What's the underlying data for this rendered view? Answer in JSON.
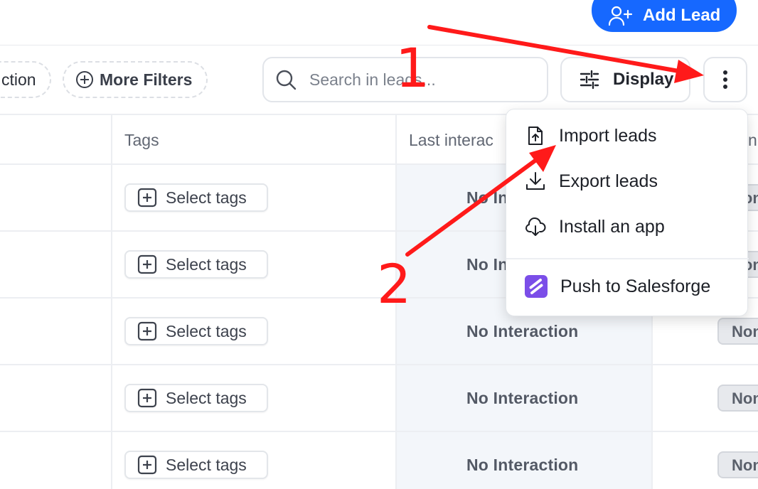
{
  "header": {
    "add_lead_label": "Add Lead"
  },
  "toolbar": {
    "action_chip_label": "ction",
    "more_filters_label": "More Filters",
    "search_placeholder": "Search in leads...",
    "display_label": "Display"
  },
  "table": {
    "columns": [
      "Tags",
      "Last interac",
      "n"
    ],
    "rows": [
      {
        "tags_label": "Select tags",
        "last_interaction": "No Interaction",
        "status": "None"
      },
      {
        "tags_label": "Select tags",
        "last_interaction": "No Interaction",
        "status": "None"
      },
      {
        "tags_label": "Select tags",
        "last_interaction": "No Interaction",
        "status": "None"
      },
      {
        "tags_label": "Select tags",
        "last_interaction": "No Interaction",
        "status": "None"
      },
      {
        "tags_label": "Select tags",
        "last_interaction": "No Interaction",
        "status": "None"
      }
    ]
  },
  "menu": {
    "items": [
      {
        "label": "Import leads",
        "icon": "file-upload-icon"
      },
      {
        "label": "Export leads",
        "icon": "download-icon"
      },
      {
        "label": "Install an app",
        "icon": "cloud-download-icon"
      },
      {
        "label": "Push to Salesforge",
        "icon": "salesforge-logo-icon"
      }
    ]
  },
  "annotations": {
    "step1": "1",
    "step2": "2",
    "color": "#ff1a1a"
  },
  "colors": {
    "primary": "#1668ff",
    "salesforge": "#7b4ee8"
  }
}
